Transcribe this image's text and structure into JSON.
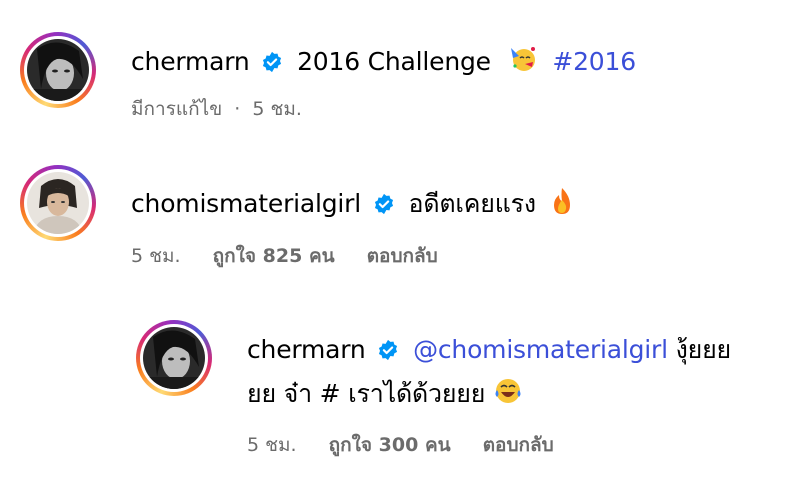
{
  "comments": [
    {
      "username": "chermarn",
      "text": "2016 Challenge",
      "hashtag": "#2016",
      "emoji_icon": "partying-face-emoji",
      "edited_label": "มีการแก้ไข",
      "time": "5 ชม.",
      "separator": "·"
    },
    {
      "username": "chomismaterialgirl",
      "text": "อดีตเคยแรง",
      "emoji_icon": "fire-emoji",
      "time": "5 ชม.",
      "likes": "ถูกใจ 825 คน",
      "reply": "ตอบกลับ"
    }
  ],
  "reply": {
    "username": "chermarn",
    "mention": "@chomismaterialgirl",
    "text_line1_end": "งุ้ยยย",
    "text_line2": "ยย จ๋า # เราได้ด้วยยย",
    "emoji_icon": "laughing-tears-emoji",
    "time": "5 ชม.",
    "likes": "ถูกใจ 300 คน",
    "reply": "ตอบกลับ"
  },
  "colors": {
    "link": "#3b4fd8",
    "verified": "#0095f6",
    "meta": "#6b6b6b"
  }
}
